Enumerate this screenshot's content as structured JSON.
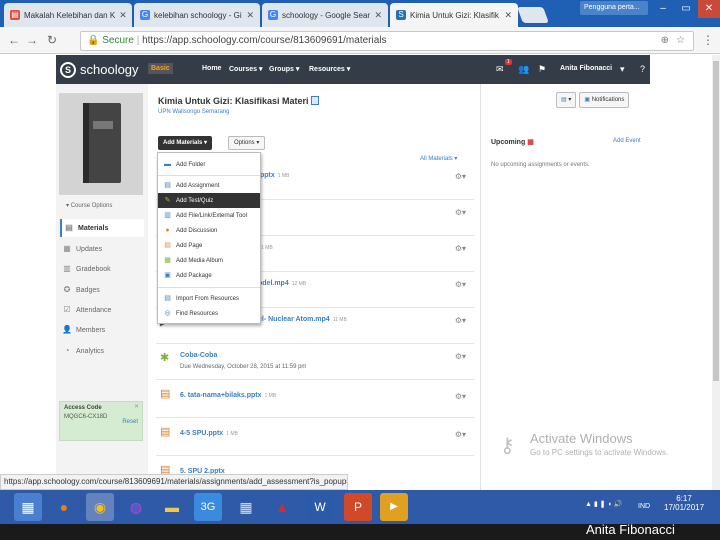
{
  "browser": {
    "tabs": [
      {
        "title": "Makalah Kelebihan dan K",
        "icon_color": "#e34b3b"
      },
      {
        "title": "kelebihan schoology - Gi",
        "icon_color": "#4285f4"
      },
      {
        "title": "schoology - Google Sear",
        "icon_color": "#4285f4"
      },
      {
        "title": "Kimia Untuk Gizi: Klasifik",
        "icon_color": "#2a6fb4"
      }
    ],
    "profile_chip": "Pengguna perta...",
    "secure_label": "Secure",
    "url": "https://app.schoology.com/course/813609691/materials"
  },
  "nav": {
    "logo": "schoology",
    "basic_badge": "Basic",
    "links": [
      "Home",
      "Courses",
      "Groups",
      "Resources"
    ],
    "user_name": "Anita Fibonacci",
    "notif_count": "1"
  },
  "sidebar": {
    "course_options": "Course Options",
    "items": [
      {
        "label": "Materials",
        "icon": "materials-icon"
      },
      {
        "label": "Updates",
        "icon": "updates-icon"
      },
      {
        "label": "Gradebook",
        "icon": "gradebook-icon"
      },
      {
        "label": "Badges",
        "icon": "badges-icon"
      },
      {
        "label": "Attendance",
        "icon": "attendance-icon"
      },
      {
        "label": "Members",
        "icon": "members-icon"
      },
      {
        "label": "Analytics",
        "icon": "analytics-icon"
      }
    ],
    "access_code_title": "Access Code",
    "access_code": "MQGC6-CX18D",
    "reset_label": "Reset"
  },
  "main": {
    "course_title": "Kimia Untuk Gizi: Klasifikasi Materi",
    "course_subtitle": "UPN Walisongo Semarang",
    "add_materials": "Add Materials",
    "options": "Options",
    "all_materials": "All Materials",
    "materials": [
      {
        "title": ".pptx",
        "size": "1 MB",
        "sub": "",
        "icon": "pptx"
      },
      {
        "title": "",
        "size": "",
        "sub": "",
        "icon": "file"
      },
      {
        "title": "",
        "size": "1 MB",
        "sub": "",
        "icon": "file"
      },
      {
        "title": "odel.mp4",
        "size": "12 MB",
        "sub": "",
        "icon": "video"
      },
      {
        "title": "el- Nuclear Atom.mp4",
        "size": "11 MB",
        "sub": "",
        "icon": "video"
      },
      {
        "title": "Coba-Coba",
        "size": "",
        "sub": "Due Wednesday, October 28, 2015 at 11:59 pm",
        "icon": "assignment"
      },
      {
        "title": "6. tata-nama+bilaks.pptx",
        "size": "1 MB",
        "sub": "",
        "icon": "pptx"
      },
      {
        "title": "4-5 SPU.pptx",
        "size": "1 MB",
        "sub": "",
        "icon": "pptx"
      },
      {
        "title": "5. SPU 2.pptx",
        "size": "",
        "sub": "",
        "icon": "pptx"
      }
    ]
  },
  "dropdown": {
    "items": [
      {
        "label": "Add Folder",
        "icon": "folder-icon",
        "highlight": false
      },
      {
        "label": "Add Assignment",
        "icon": "assignment-icon",
        "highlight": false
      },
      {
        "label": "Add Test/Quiz",
        "icon": "quiz-icon",
        "highlight": true
      },
      {
        "label": "Add File/Link/External Tool",
        "icon": "file-link-icon",
        "highlight": false
      },
      {
        "label": "Add Discussion",
        "icon": "discussion-icon",
        "highlight": false
      },
      {
        "label": "Add Page",
        "icon": "page-icon",
        "highlight": false
      },
      {
        "label": "Add Media Album",
        "icon": "media-album-icon",
        "highlight": false
      },
      {
        "label": "Add Package",
        "icon": "package-icon",
        "highlight": false
      },
      {
        "label": "Import From Resources",
        "icon": "import-icon",
        "highlight": false
      },
      {
        "label": "Find Resources",
        "icon": "find-resources-icon",
        "highlight": false
      }
    ]
  },
  "right": {
    "upcoming": "Upcoming",
    "add_event": "Add Event",
    "no_events": "No upcoming assignments or events.",
    "notifications": "Notifications"
  },
  "watermark": {
    "line1": "Activate Windows",
    "line2": "Go to PC settings to activate Windows."
  },
  "statusbar": "https://app.schoology.com/course/813609691/materials/assignments/add_assessment?is_popup=1",
  "taskbar": {
    "lang": "IND",
    "time": "6:17",
    "date": "17/01/2017"
  },
  "presenter": "Anita Fibonacci",
  "colors": {
    "nav_bg": "#333c47",
    "link_blue": "#3a7fc2",
    "taskbar": "#2f5aa8"
  }
}
